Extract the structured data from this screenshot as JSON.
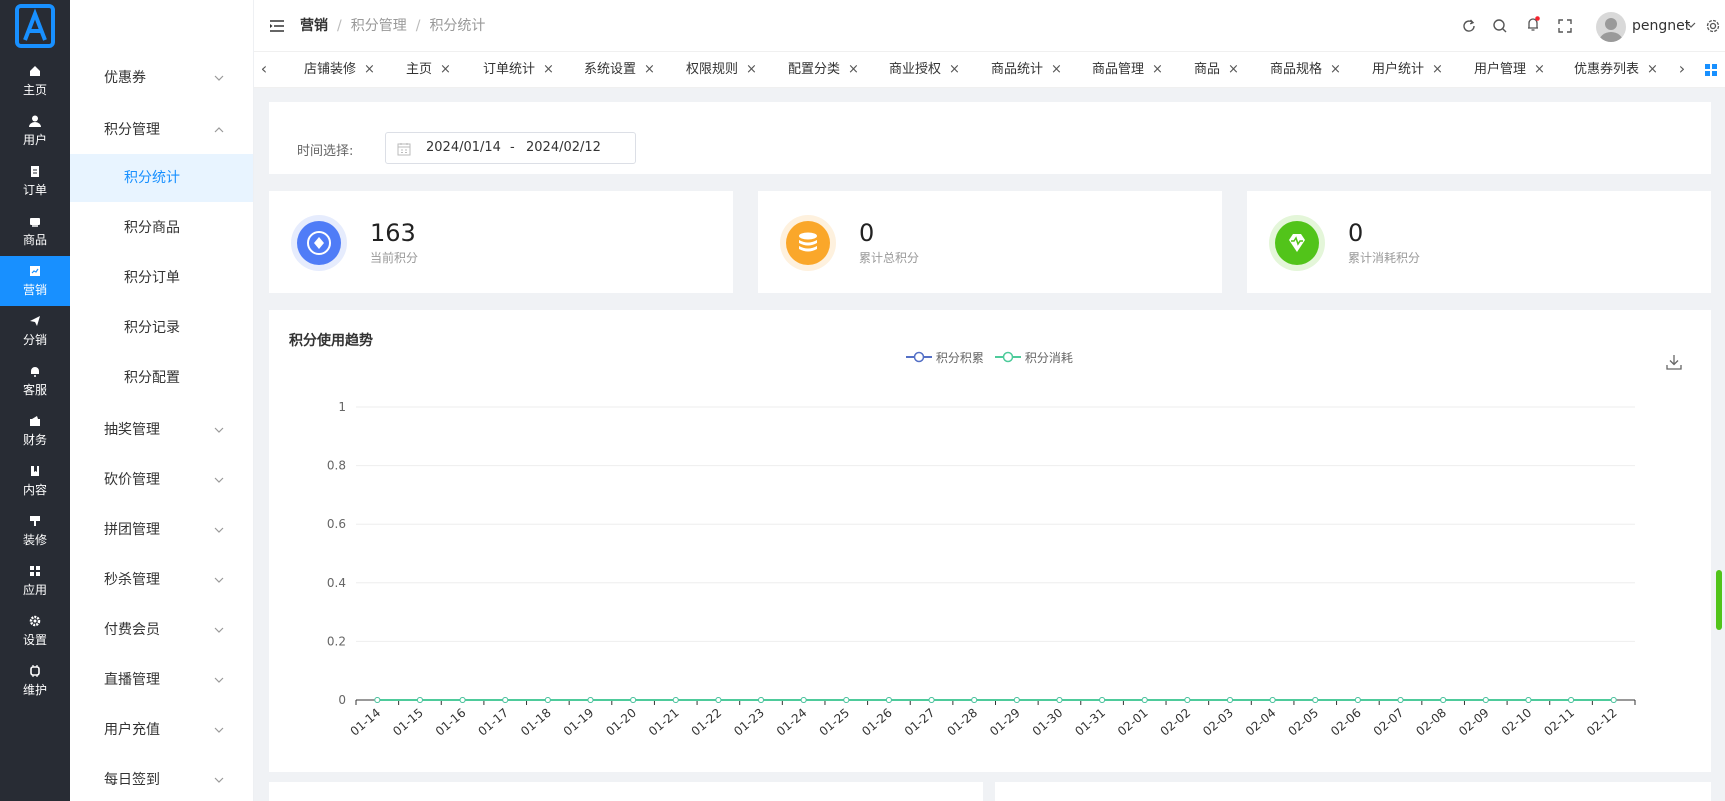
{
  "rail": {
    "items": [
      {
        "label": "主页"
      },
      {
        "label": "用户"
      },
      {
        "label": "订单"
      },
      {
        "label": "商品"
      },
      {
        "label": "营销"
      },
      {
        "label": "分销"
      },
      {
        "label": "客服"
      },
      {
        "label": "财务"
      },
      {
        "label": "内容"
      },
      {
        "label": "装修"
      },
      {
        "label": "应用"
      },
      {
        "label": "设置"
      },
      {
        "label": "维护"
      }
    ]
  },
  "submenu": {
    "coupon": "优惠券",
    "points": "积分管理",
    "children": [
      "积分统计",
      "积分商品",
      "积分订单",
      "积分记录",
      "积分配置"
    ],
    "groups": [
      "抽奖管理",
      "砍价管理",
      "拼团管理",
      "秒杀管理",
      "付费会员",
      "直播管理",
      "用户充值",
      "每日签到"
    ]
  },
  "header": {
    "crumb_1": "营销",
    "crumb_2": "积分管理",
    "crumb_3": "积分统计",
    "crumb_sep": "/",
    "username": "pengnet"
  },
  "tabs": [
    "店铺装修",
    "主页",
    "订单统计",
    "系统设置",
    "权限规则",
    "配置分类",
    "商业授权",
    "商品统计",
    "商品管理",
    "商品",
    "商品规格",
    "用户统计",
    "用户管理",
    "优惠券列表"
  ],
  "tab_close": "×",
  "filter": {
    "label": "时间选择:",
    "start": "2024/01/14",
    "dash": "-",
    "end": "2024/02/12"
  },
  "stats": [
    {
      "value": "163",
      "label": "当前积分",
      "color": "#4f7cf7"
    },
    {
      "value": "0",
      "label": "累计总积分",
      "color": "#faa72a"
    },
    {
      "value": "0",
      "label": "累计消耗积分",
      "color": "#52c41a"
    }
  ],
  "chart_data": {
    "type": "line",
    "title": "积分使用趋势",
    "categories": [
      "01-14",
      "01-15",
      "01-16",
      "01-17",
      "01-18",
      "01-19",
      "01-20",
      "01-21",
      "01-22",
      "01-23",
      "01-24",
      "01-25",
      "01-26",
      "01-27",
      "01-28",
      "01-29",
      "01-30",
      "01-31",
      "02-01",
      "02-02",
      "02-03",
      "02-04",
      "02-05",
      "02-06",
      "02-07",
      "02-08",
      "02-09",
      "02-10",
      "02-11",
      "02-12"
    ],
    "series": [
      {
        "name": "积分积累",
        "color": "#5470c6",
        "values": [
          0,
          0,
          0,
          0,
          0,
          0,
          0,
          0,
          0,
          0,
          0,
          0,
          0,
          0,
          0,
          0,
          0,
          0,
          0,
          0,
          0,
          0,
          0,
          0,
          0,
          0,
          0,
          0,
          0,
          0
        ]
      },
      {
        "name": "积分消耗",
        "color": "#4ecb9b",
        "values": [
          0,
          0,
          0,
          0,
          0,
          0,
          0,
          0,
          0,
          0,
          0,
          0,
          0,
          0,
          0,
          0,
          0,
          0,
          0,
          0,
          0,
          0,
          0,
          0,
          0,
          0,
          0,
          0,
          0,
          0
        ]
      }
    ],
    "ylim": [
      0,
      1
    ],
    "yticks": [
      0,
      0.2,
      0.4,
      0.6,
      0.8,
      1
    ],
    "grid": true,
    "legend": "top-center"
  }
}
